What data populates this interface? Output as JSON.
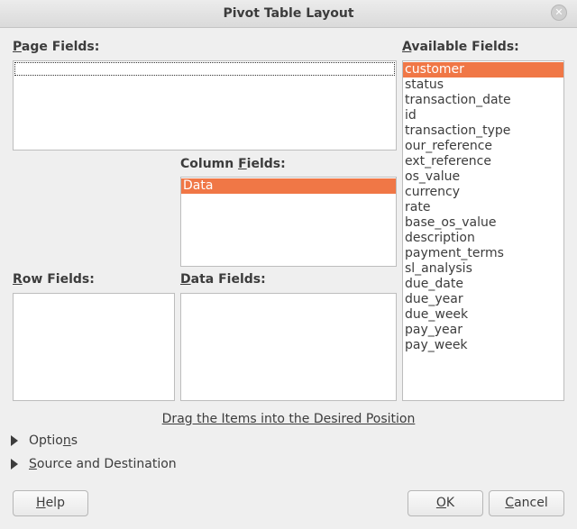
{
  "window": {
    "title": "Pivot Table Layout",
    "close_icon": "close-icon"
  },
  "page_fields": {
    "label_u": "P",
    "label_rest": "age Fields:",
    "items": []
  },
  "available_fields": {
    "label_u": "A",
    "label_rest": "vailable Fields:",
    "selected": "customer",
    "items": [
      "customer",
      "status",
      "transaction_date",
      "id",
      "transaction_type",
      "our_reference",
      "ext_reference",
      "os_value",
      "currency",
      "rate",
      "base_os_value",
      "description",
      "payment_terms",
      "sl_analysis",
      "due_date",
      "due_year",
      "due_week",
      "pay_year",
      "pay_week"
    ]
  },
  "column_fields": {
    "label_pre": "Column ",
    "label_u": "F",
    "label_rest": "ields:",
    "items": [
      "Data"
    ],
    "selected": "Data"
  },
  "row_fields": {
    "label_u": "R",
    "label_rest": "ow Fields:",
    "items": []
  },
  "data_fields": {
    "label_u": "D",
    "label_rest": "ata Fields:",
    "items": []
  },
  "hint": "Drag the Items into the Desired Position",
  "options": {
    "label_pre": "Optio",
    "label_u": "n",
    "label_rest": "s"
  },
  "source_destination": {
    "label_u": "S",
    "label_rest": "ource and Destination"
  },
  "buttons": {
    "help": {
      "u": "H",
      "rest": "elp"
    },
    "ok": {
      "u": "O",
      "rest": "K"
    },
    "cancel": {
      "u": "C",
      "rest": "ancel"
    }
  }
}
